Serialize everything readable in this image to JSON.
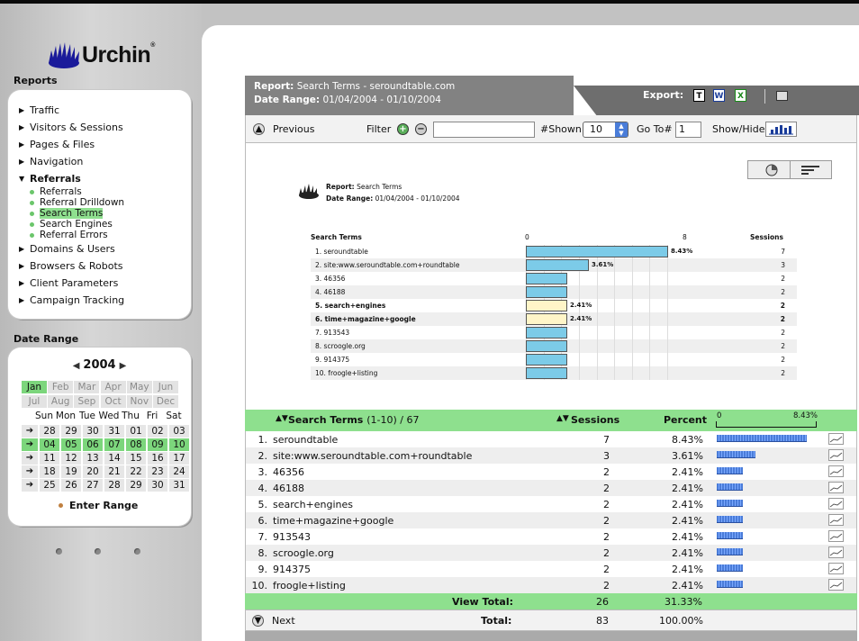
{
  "brand": {
    "name": "Urchin",
    "reg": "®"
  },
  "sidebar": {
    "reports_heading": "Reports",
    "nav": [
      {
        "label": "Traffic",
        "expanded": false
      },
      {
        "label": "Visitors & Sessions",
        "expanded": false
      },
      {
        "label": "Pages & Files",
        "expanded": false
      },
      {
        "label": "Navigation",
        "expanded": false
      },
      {
        "label": "Referrals",
        "expanded": true
      },
      {
        "label": "Domains & Users",
        "expanded": false
      },
      {
        "label": "Browsers & Robots",
        "expanded": false
      },
      {
        "label": "Client Parameters",
        "expanded": false
      },
      {
        "label": "Campaign Tracking",
        "expanded": false
      }
    ],
    "referrals_sub": [
      {
        "label": "Referrals",
        "active": false
      },
      {
        "label": "Referral Drilldown",
        "active": false
      },
      {
        "label": "Search Terms",
        "active": true
      },
      {
        "label": "Search Engines",
        "active": false
      },
      {
        "label": "Referral Errors",
        "active": false
      }
    ],
    "date_heading": "Date Range"
  },
  "calendar": {
    "year": "2004",
    "months": [
      "Jan",
      "Feb",
      "Mar",
      "Apr",
      "May",
      "Jun",
      "Jul",
      "Aug",
      "Sep",
      "Oct",
      "Nov",
      "Dec"
    ],
    "selected_month": "Jan",
    "weekdays": [
      "Sun",
      "Mon",
      "Tue",
      "Wed",
      "Thu",
      "Fri",
      "Sat"
    ],
    "weeks": [
      [
        "28",
        "29",
        "30",
        "31",
        "01",
        "02",
        "03"
      ],
      [
        "04",
        "05",
        "06",
        "07",
        "08",
        "09",
        "10"
      ],
      [
        "11",
        "12",
        "13",
        "14",
        "15",
        "16",
        "17"
      ],
      [
        "18",
        "19",
        "20",
        "21",
        "22",
        "23",
        "24"
      ],
      [
        "25",
        "26",
        "27",
        "28",
        "29",
        "30",
        "31"
      ]
    ],
    "highlighted_week": 1,
    "enter_range": "Enter Range"
  },
  "report": {
    "report_label": "Report:",
    "report_value": "Search Terms - seroundtable.com",
    "range_label": "Date Range:",
    "range_value": "01/04/2004 - 01/10/2004",
    "export_label": "Export:",
    "export_icons": [
      "text-export-icon",
      "word-export-icon",
      "excel-export-icon",
      "print-icon"
    ]
  },
  "toolbar": {
    "previous": "Previous",
    "filter": "Filter",
    "filter_value": "",
    "shown_label": "#Shown",
    "shown_value": "10",
    "goto_label": "Go To#",
    "goto_value": "1",
    "showhide": "Show/Hide"
  },
  "chart_data": {
    "type": "bar",
    "title": "Search Terms",
    "header_report_label": "Report:",
    "header_report_value": "Search Terms",
    "header_range_label": "Date Range:",
    "header_range_value": "01/04/2004 - 01/10/2004",
    "col_label": "Search Terms",
    "sessions_label": "Sessions",
    "axis_min": "0",
    "axis_max": "8",
    "xlim": [
      0,
      8
    ],
    "categories": [
      "1. seroundtable",
      "2. site:www.seroundtable.com+roundtable",
      "3. 46356",
      "4. 46188",
      "5. search+engines",
      "6. time+magazine+google",
      "7. 913543",
      "8. scroogle.org",
      "9. 914375",
      "10. froogle+listing"
    ],
    "values": [
      7,
      3,
      2,
      2,
      2,
      2,
      2,
      2,
      2,
      2
    ],
    "bar_labels": [
      "8.43%",
      "3.61%",
      "",
      "",
      "2.41%",
      "2.41%",
      "",
      "",
      "",
      ""
    ],
    "highlighted": [
      false,
      false,
      false,
      false,
      true,
      true,
      false,
      false,
      false,
      false
    ]
  },
  "table": {
    "header": {
      "term": "Search Terms",
      "range": "(1-10) / 67",
      "sessions": "Sessions",
      "percent": "Percent",
      "scale_min": "0",
      "scale_max": "8.43%"
    },
    "rows": [
      {
        "idx": "1.",
        "term": "seroundtable",
        "sessions": "7",
        "percent": "8.43%",
        "frac": 1.0
      },
      {
        "idx": "2.",
        "term": "site:www.seroundtable.com+roundtable",
        "sessions": "3",
        "percent": "3.61%",
        "frac": 0.428
      },
      {
        "idx": "3.",
        "term": "46356",
        "sessions": "2",
        "percent": "2.41%",
        "frac": 0.286
      },
      {
        "idx": "4.",
        "term": "46188",
        "sessions": "2",
        "percent": "2.41%",
        "frac": 0.286
      },
      {
        "idx": "5.",
        "term": "search+engines",
        "sessions": "2",
        "percent": "2.41%",
        "frac": 0.286
      },
      {
        "idx": "6.",
        "term": "time+magazine+google",
        "sessions": "2",
        "percent": "2.41%",
        "frac": 0.286
      },
      {
        "idx": "7.",
        "term": "913543",
        "sessions": "2",
        "percent": "2.41%",
        "frac": 0.286
      },
      {
        "idx": "8.",
        "term": "scroogle.org",
        "sessions": "2",
        "percent": "2.41%",
        "frac": 0.286
      },
      {
        "idx": "9.",
        "term": "914375",
        "sessions": "2",
        "percent": "2.41%",
        "frac": 0.286
      },
      {
        "idx": "10.",
        "term": "froogle+listing",
        "sessions": "2",
        "percent": "2.41%",
        "frac": 0.286
      }
    ],
    "view_total_label": "View Total:",
    "view_total_sessions": "26",
    "view_total_percent": "31.33%",
    "next": "Next",
    "total_label": "Total:",
    "total_sessions": "83",
    "total_percent": "100.00%"
  }
}
